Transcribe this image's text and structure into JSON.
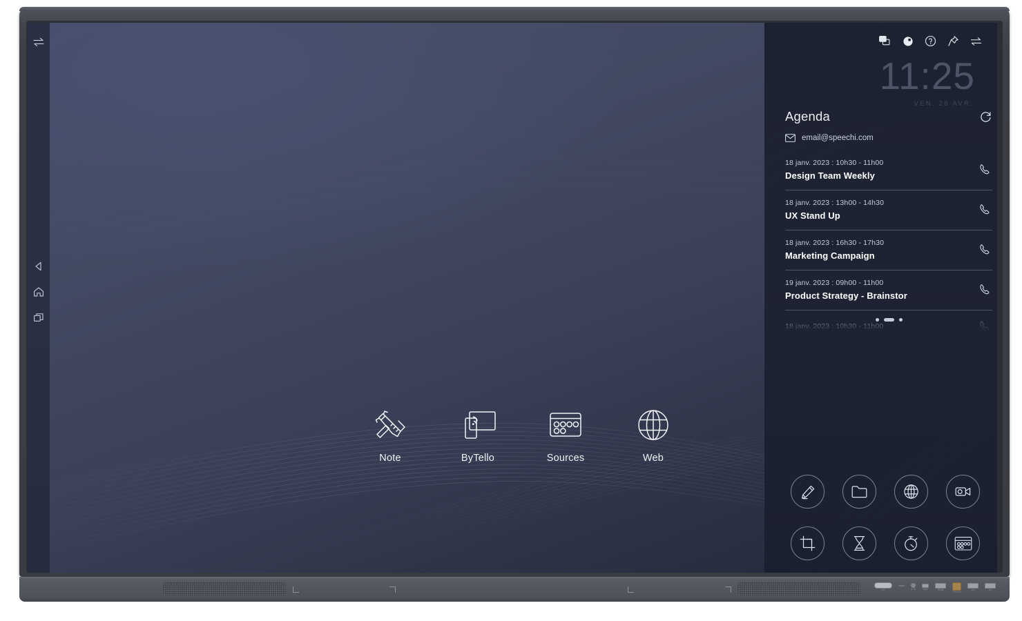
{
  "device": {
    "type": "interactive-flat-panel-display",
    "ports": [
      {
        "name": "power-port",
        "label": "PC"
      },
      {
        "name": "dash-port",
        "label": ""
      },
      {
        "name": "audio-jack-port",
        "label": "A-IN"
      },
      {
        "name": "micro-usb-port",
        "label": "USB"
      },
      {
        "name": "hdmi-port",
        "label": "HDMI"
      },
      {
        "name": "touch-port",
        "label": "TOUCH"
      },
      {
        "name": "usb-a-port-1",
        "label": "U1"
      },
      {
        "name": "usb-a-port-2",
        "label": "U2"
      }
    ]
  },
  "nav_rail": {
    "items": [
      {
        "name": "back",
        "icon": "back-triangle-icon"
      },
      {
        "name": "home",
        "icon": "home-icon"
      },
      {
        "name": "recents",
        "icon": "recents-icon"
      }
    ]
  },
  "top_left": {
    "toggle_icon": "swap-arrows-icon"
  },
  "status_bar": {
    "icons": [
      {
        "name": "multi-window-icon"
      },
      {
        "name": "brightness-icon"
      },
      {
        "name": "help-icon"
      },
      {
        "name": "pin-icon"
      },
      {
        "name": "swap-arrows-icon"
      }
    ]
  },
  "clock": {
    "time": "11:25",
    "date": "VEN. 28 AVR."
  },
  "agenda": {
    "title": "Agenda",
    "refresh_icon": "refresh-icon",
    "mail_icon": "envelope-icon",
    "email": "email@speechi.com",
    "call_icon": "phone-icon",
    "events": [
      {
        "when": "18 janv. 2023 : 10h30 - 11h00",
        "what": "Design Team Weekly"
      },
      {
        "when": "18 janv. 2023 : 13h00 - 14h30",
        "what": "UX Stand Up"
      },
      {
        "when": "18 janv. 2023 : 16h30 - 17h30",
        "what": "Marketing Campaign"
      },
      {
        "when": "19 janv. 2023 : 09h00 - 11h00",
        "what": "Product Strategy - Brainstor"
      },
      {
        "when": "18 janv. 2023 : 10h30 - 11h00",
        "what": ""
      }
    ],
    "pagination": {
      "total": 3,
      "active": 2
    }
  },
  "apps": [
    {
      "label": "Note",
      "icon": "pen-ruler-icon"
    },
    {
      "label": "ByTello",
      "icon": "screen-cast-icon"
    },
    {
      "label": "Sources",
      "icon": "sources-panel-icon"
    },
    {
      "label": "Web",
      "icon": "globe-icon"
    }
  ],
  "tools": [
    {
      "name": "annotate-tool",
      "icon": "pencil-icon"
    },
    {
      "name": "files-tool",
      "icon": "folder-icon"
    },
    {
      "name": "browser-tool",
      "icon": "globe-icon"
    },
    {
      "name": "record-tool",
      "icon": "video-camera-icon"
    },
    {
      "name": "crop-tool",
      "icon": "crop-icon"
    },
    {
      "name": "hourglass-tool",
      "icon": "hourglass-icon"
    },
    {
      "name": "stopwatch-tool",
      "icon": "stopwatch-icon"
    },
    {
      "name": "sources-tool",
      "icon": "sources-panel-icon"
    }
  ],
  "colors": {
    "wallpaper_top": "#474e68",
    "wallpaper_bottom": "#23273a",
    "panel_bg": "#1e2333",
    "rail_bg": "#2a3044",
    "text_primary": "#ffffff",
    "text_secondary": "#c7ccd7",
    "clock_gray": "#4d5465",
    "bezel": "#3c3f45",
    "bottom_bezel": "#565a62"
  }
}
